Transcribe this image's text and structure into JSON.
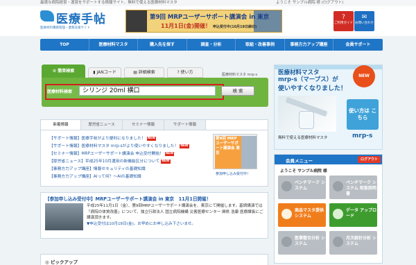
{
  "topbar": {
    "tagline": "最適な病院経営・運営をサポートする情報サイト、無料で使える医療材料マスタ",
    "welcome": "ようこそ サンプル病院 様",
    "logout_link": "(ログアウト)"
  },
  "logo": {
    "name": "医療手帖",
    "sub": "医療材料購買管理・業務支援サイト"
  },
  "banner": {
    "line1": "第9回 MRPユーザーサポート講演会 in 東京",
    "line2": "11月1日(金)開催！",
    "line2_small": "申込受付中(10月18日締切)"
  },
  "header_buttons": [
    {
      "label": "ご利用ガイド",
      "icon": "?"
    },
    {
      "label": "お問い合わせ",
      "icon": "✉"
    }
  ],
  "nav": [
    "TOP",
    "医療材料マスタ",
    "購入先を探す",
    "調査・分析",
    "取組・改善事例",
    "事務方力アップ講座",
    "会員サポート"
  ],
  "search": {
    "tabs": [
      "簡単検索",
      "JANコード",
      "詳細検索",
      "使い方"
    ],
    "brand": "医療材料マスタ mrp-s",
    "label": "医療材料検索",
    "value": "シリンジ 20ml 横口",
    "button": "検 索"
  },
  "promo": {
    "line1": "医療材料マスタ",
    "line2": "mrp-s（マープス）が",
    "line3": "使いやすくなりました！",
    "new_badge": "NEW",
    "howto": "使い方は こちら",
    "footer": "無料で使える医療材料マスタ",
    "footer_logo": "mrp-s"
  },
  "news": {
    "tabs": [
      "新着情報",
      "厚労省ニュース",
      "セミナー情報",
      "サポート情報"
    ],
    "items": [
      {
        "text": "【サポート情報】医療手帖がより便利になりました！",
        "badge": "NEW"
      },
      {
        "text": "【サポート情報】医療材料マスタ mrp-sがより使いやすくなりました！",
        "badge": "NEW"
      },
      {
        "text": "【セミナー情報】MRPユーザーサポート講演会 申込受付開始！",
        "badge": "NEW"
      },
      {
        "text": "【厚労省ニュース】平成25年10月運用の新機能区分について",
        "badge": "NEW"
      },
      {
        "text": "【事務方力アップ講座】情報セキュリティの基礎知識",
        "badge": ""
      },
      {
        "text": "【事務方力アップ講座】AIって何？～AIの基礎知識",
        "badge": ""
      }
    ],
    "image_text": "第9回 MRP ユーザーサポート講演会 東京",
    "image_caption": "参加申し込み受付中！",
    "more_link": "一覧"
  },
  "event": {
    "title": "【参加申し込み受付中】MRPユーザーサポート講演会 in 東京　11月1日開催！",
    "body": "平成25年11月1日（金）、第9回MRPユーザーサポート講演会を、東京にて開催します。基調講演では「病院の体質改善」について、独立行政法人 国立病院機構 災害医療センター 関県 浩康 医療課長にご講演頂きます。",
    "deadline": "▼申込受付は10月18日(金)。お早めにお申し込み下さいませ。"
  },
  "pickup": {
    "title": "ピックアップ"
  },
  "member": {
    "header": "会員メニュー",
    "logout": "ログアウト",
    "welcome": "ようこそ サンプル病院 様",
    "buttons": [
      {
        "label": "ベンチマーク システム",
        "style": "gray"
      },
      {
        "label": "ベンチマーク システム 取扱説明書",
        "style": "gray"
      },
      {
        "label": "商品マスタ提供 システム",
        "style": "orange"
      },
      {
        "label": "データ アップロード",
        "style": "green"
      },
      {
        "label": "医事整合分析 システム",
        "style": "gray"
      },
      {
        "label": "月次統計分析 システム",
        "style": "gray"
      }
    ]
  }
}
